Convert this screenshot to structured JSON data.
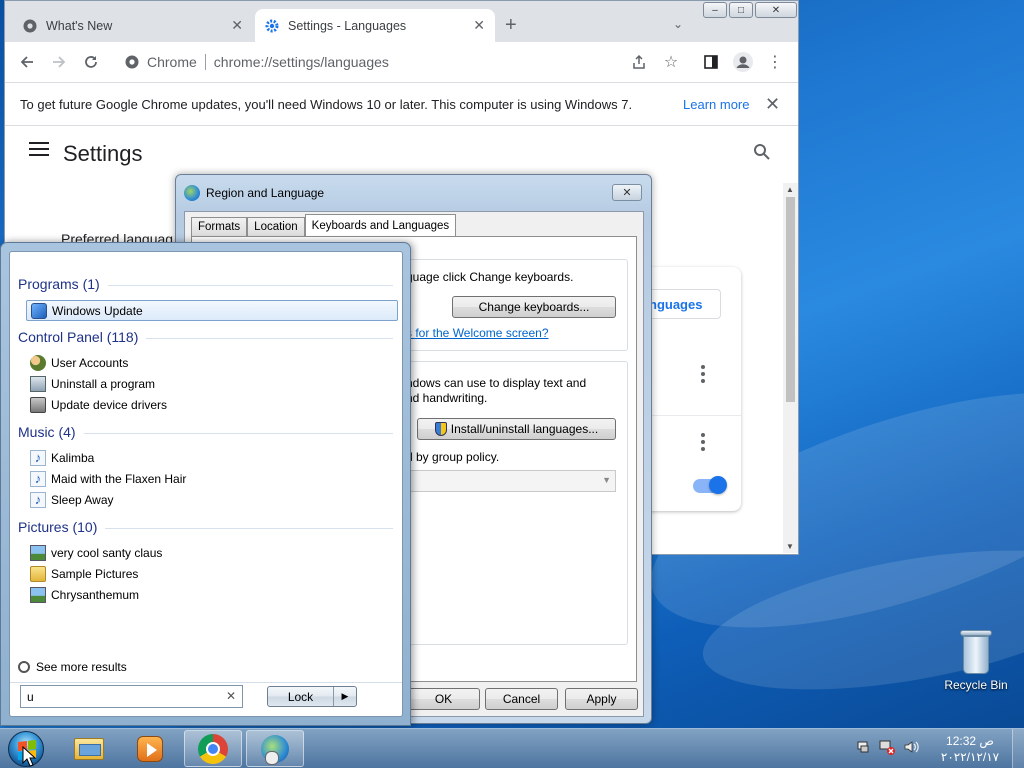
{
  "chrome": {
    "tabs": [
      {
        "label": "What's New",
        "icon": "chrome-icon",
        "active": false
      },
      {
        "label": "Settings - Languages",
        "icon": "gear-icon",
        "active": true
      }
    ],
    "new_tab_glyph": "+",
    "address": {
      "site_label": "Chrome",
      "url": "chrome://settings/languages"
    },
    "infobar": {
      "message": "To get future Google Chrome updates, you'll need Windows 10 or later. This computer is using Windows 7.",
      "learn_more": "Learn more"
    },
    "settings": {
      "title": "Settings",
      "preferred_languages": "Preferred languag",
      "add_languages_button": "nguages"
    }
  },
  "region_dialog": {
    "title": "Region and Language",
    "tabs": [
      "Formats",
      "Location",
      "Keyboards and Languages"
    ],
    "selected_tab": "Keyboards and Languages",
    "keyboard_text": "guage click Change keyboards.",
    "change_keyboards_button": "Change keyboards...",
    "welcome_link": "s for the Welcome screen?",
    "display_text_line1": "ndows can use to display text and",
    "display_text_line2": "nd handwriting.",
    "install_button": "Install/uninstall languages...",
    "group_policy_text": "d by group policy.",
    "ok_button": "OK",
    "cancel_button": "Cancel",
    "apply_button": "Apply"
  },
  "start_menu": {
    "groups": [
      {
        "heading": "Programs (1)",
        "items": [
          {
            "label": "Windows Update",
            "icon": "windows-update-icon"
          }
        ]
      },
      {
        "heading": "Control Panel (118)",
        "items": [
          {
            "label": "User Accounts",
            "icon": "user-accounts-icon"
          },
          {
            "label": "Uninstall a program",
            "icon": "programs-icon"
          },
          {
            "label": "Update device drivers",
            "icon": "device-driver-icon"
          }
        ]
      },
      {
        "heading": "Music (4)",
        "items": [
          {
            "label": "Kalimba",
            "icon": "music-file-icon"
          },
          {
            "label": "Maid with the Flaxen Hair",
            "icon": "music-file-icon"
          },
          {
            "label": "Sleep Away",
            "icon": "music-file-icon"
          }
        ]
      },
      {
        "heading": "Pictures (10)",
        "items": [
          {
            "label": "very cool santy claus",
            "icon": "picture-file-icon"
          },
          {
            "label": "Sample Pictures",
            "icon": "folder-icon"
          },
          {
            "label": "Chrysanthemum",
            "icon": "picture-file-icon"
          }
        ]
      }
    ],
    "see_more": "See more results",
    "search_value": "u",
    "lock_button": "Lock"
  },
  "desktop": {
    "recycle_bin": "Recycle Bin"
  },
  "taskbar": {
    "clock_time": "12:32 ص",
    "clock_date": "٢٠٢٢/١٢/١٧"
  }
}
